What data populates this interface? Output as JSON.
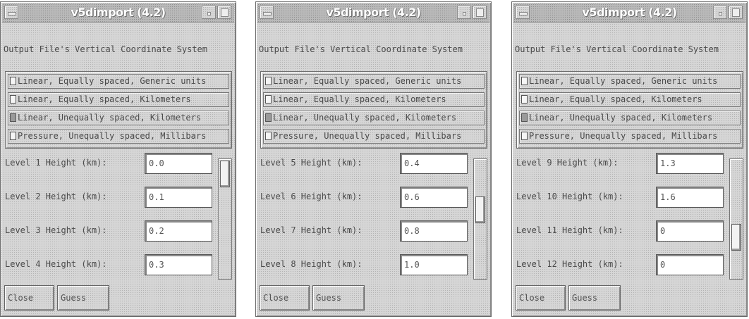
{
  "windows": [
    {
      "title": "v5dimport (4.2)",
      "heading": "Output File's Vertical Coordinate System",
      "options": [
        {
          "label": "Linear, Equally spaced, Generic units",
          "selected": false
        },
        {
          "label": "Linear, Equally spaced, Kilometers",
          "selected": false
        },
        {
          "label": "Linear, Unequally spaced, Kilometers",
          "selected": true
        },
        {
          "label": "Pressure, Unequally spaced, Millibars",
          "selected": false
        }
      ],
      "levels": [
        {
          "label": "Level 1 Height (km):",
          "value": "0.0"
        },
        {
          "label": "Level 2 Height (km):",
          "value": "0.1"
        },
        {
          "label": "Level 3 Height (km):",
          "value": "0.2"
        },
        {
          "label": "Level 4 Height (km):",
          "value": "0.3"
        }
      ],
      "scroll_position": 0.0,
      "buttons": {
        "close": "Close",
        "guess": "Guess"
      }
    },
    {
      "title": "v5dimport (4.2)",
      "heading": "Output File's Vertical Coordinate System",
      "options": [
        {
          "label": "Linear, Equally spaced, Generic units",
          "selected": false
        },
        {
          "label": "Linear, Equally spaced, Kilometers",
          "selected": false
        },
        {
          "label": "Linear, Unequally spaced, Kilometers",
          "selected": true
        },
        {
          "label": "Pressure, Unequally spaced, Millibars",
          "selected": false
        }
      ],
      "levels": [
        {
          "label": "Level 5 Height (km):",
          "value": "0.4"
        },
        {
          "label": "Level 6 Height (km):",
          "value": "0.6"
        },
        {
          "label": "Level 7 Height (km):",
          "value": "0.8"
        },
        {
          "label": "Level 8 Height (km):",
          "value": "1.0"
        }
      ],
      "scroll_position": 0.4,
      "buttons": {
        "close": "Close",
        "guess": "Guess"
      }
    },
    {
      "title": "v5dimport (4.2)",
      "heading": "Output File's Vertical Coordinate System",
      "options": [
        {
          "label": "Linear, Equally spaced, Generic units",
          "selected": false
        },
        {
          "label": "Linear, Equally spaced, Kilometers",
          "selected": false
        },
        {
          "label": "Linear, Unequally spaced, Kilometers",
          "selected": true
        },
        {
          "label": "Pressure, Unequally spaced, Millibars",
          "selected": false
        }
      ],
      "levels": [
        {
          "label": "Level 9 Height (km):",
          "value": "1.3"
        },
        {
          "label": "Level 10 Height (km):",
          "value": "1.6"
        },
        {
          "label": "Level 11 Height (km):",
          "value": "0"
        },
        {
          "label": "Level 12 Height (km):",
          "value": "0"
        }
      ],
      "scroll_position": 0.7,
      "buttons": {
        "close": "Close",
        "guess": "Guess"
      }
    }
  ]
}
